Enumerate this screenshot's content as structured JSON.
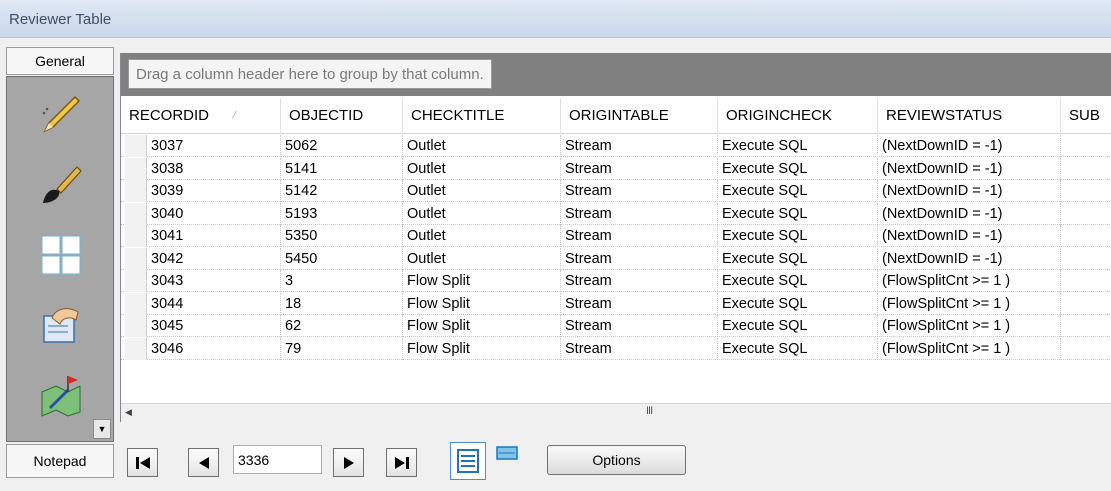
{
  "window": {
    "title": "Reviewer Table"
  },
  "toolbox": {
    "top_tab": "General",
    "bottom_tab": "Notepad",
    "tools": [
      "pencil-icon",
      "brush-icon",
      "grid-icon",
      "hand-document-icon",
      "map-flag-icon"
    ]
  },
  "grid": {
    "group_hint": "Drag a column header here to group by that column.",
    "columns": [
      "RECORDID",
      "OBJECTID",
      "CHECKTITLE",
      "ORIGINTABLE",
      "ORIGINCHECK",
      "REVIEWSTATUS",
      "SUB"
    ],
    "rows": [
      [
        "3037",
        "5062",
        "Outlet",
        "Stream",
        "Execute SQL",
        "(NextDownID = -1)"
      ],
      [
        "3038",
        "5141",
        "Outlet",
        "Stream",
        "Execute SQL",
        "(NextDownID = -1)"
      ],
      [
        "3039",
        "5142",
        "Outlet",
        "Stream",
        "Execute SQL",
        "(NextDownID = -1)"
      ],
      [
        "3040",
        "5193",
        "Outlet",
        "Stream",
        "Execute SQL",
        "(NextDownID = -1)"
      ],
      [
        "3041",
        "5350",
        "Outlet",
        "Stream",
        "Execute SQL",
        "(NextDownID = -1)"
      ],
      [
        "3042",
        "5450",
        "Outlet",
        "Stream",
        "Execute SQL",
        "(NextDownID = -1)"
      ],
      [
        "3043",
        "3",
        "Flow Split",
        "Stream",
        "Execute SQL",
        "(FlowSplitCnt >= 1 )"
      ],
      [
        "3044",
        "18",
        "Flow Split",
        "Stream",
        "Execute SQL",
        "(FlowSplitCnt >= 1 )"
      ],
      [
        "3045",
        "62",
        "Flow Split",
        "Stream",
        "Execute SQL",
        "(FlowSplitCnt >= 1 )"
      ],
      [
        "3046",
        "79",
        "Flow Split",
        "Stream",
        "Execute SQL",
        "(FlowSplitCnt >= 1 )"
      ]
    ],
    "scrollbar_grip": "III"
  },
  "navigator": {
    "record_value": "3336",
    "options_label": "Options"
  },
  "colors": {
    "groupbar": "#808080",
    "toolbox_panel": "#a6a6a6",
    "title_bg": "#d6e1ef",
    "view_icon": "#1e73be"
  }
}
